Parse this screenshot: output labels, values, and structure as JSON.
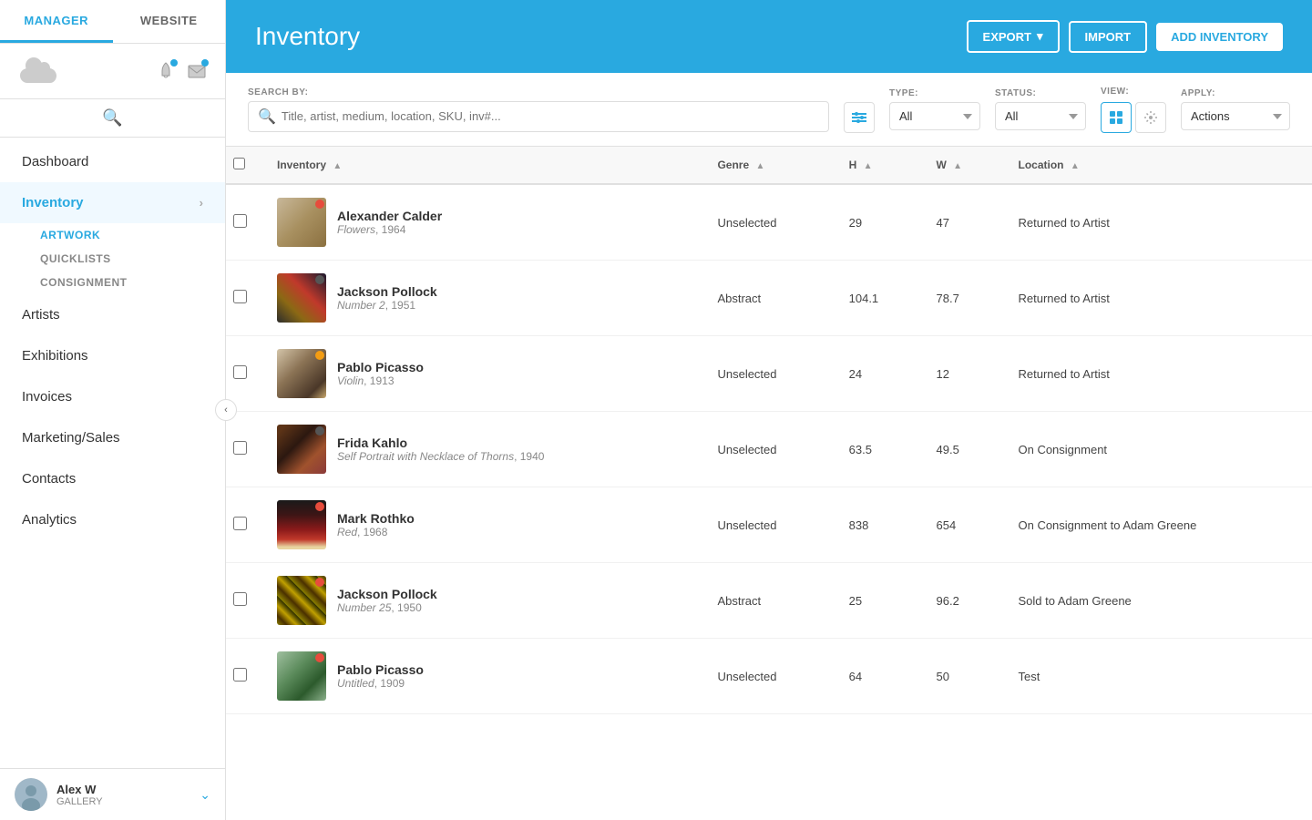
{
  "app": {
    "tab_manager": "MANAGER",
    "tab_website": "WEBSITE"
  },
  "header": {
    "title": "Inventory",
    "export_label": "EXPORT",
    "import_label": "IMPORT",
    "add_label": "ADD INVENTORY"
  },
  "filters": {
    "search_by_label": "SEARCH BY:",
    "search_placeholder": "Title, artist, medium, location, SKU, inv#...",
    "type_label": "TYPE:",
    "type_value": "All",
    "status_label": "STATUS:",
    "status_value": "All",
    "view_label": "VIEW:",
    "apply_label": "APPLY:",
    "actions_value": "Actions"
  },
  "table": {
    "columns": [
      "Inventory",
      "Genre",
      "H",
      "W",
      "Location"
    ],
    "rows": [
      {
        "id": 1,
        "artist": "Alexander Calder",
        "title": "Flowers",
        "year": "1964",
        "genre": "Unselected",
        "h": "29",
        "w": "47",
        "location": "Returned to Artist",
        "status_dot": "red",
        "thumb": "thumb-calder"
      },
      {
        "id": 2,
        "artist": "Jackson Pollock",
        "title": "Number 2",
        "year": "1951",
        "genre": "Abstract",
        "h": "104.1",
        "w": "78.7",
        "location": "Returned to Artist",
        "status_dot": "dark",
        "thumb": "thumb-pollock1"
      },
      {
        "id": 3,
        "artist": "Pablo Picasso",
        "title": "Violin",
        "year": "1913",
        "genre": "Unselected",
        "h": "24",
        "w": "12",
        "location": "Returned to Artist",
        "status_dot": "orange",
        "thumb": "thumb-picasso1"
      },
      {
        "id": 4,
        "artist": "Frida Kahlo",
        "title": "Self Portrait with Necklace of Thorns",
        "year": "1940",
        "genre": "Unselected",
        "h": "63.5",
        "w": "49.5",
        "location": "On Consignment",
        "status_dot": "dark",
        "thumb": "thumb-kahlo"
      },
      {
        "id": 5,
        "artist": "Mark Rothko",
        "title": "Red",
        "year": "1968",
        "genre": "Unselected",
        "h": "838",
        "w": "654",
        "location": "On Consignment to Adam Greene",
        "status_dot": "red",
        "thumb": "thumb-rothko"
      },
      {
        "id": 6,
        "artist": "Jackson Pollock",
        "title": "Number 25",
        "year": "1950",
        "genre": "Abstract",
        "h": "25",
        "w": "96.2",
        "location": "Sold to Adam Greene",
        "status_dot": "red",
        "thumb": "thumb-pollock2"
      },
      {
        "id": 7,
        "artist": "Pablo Picasso",
        "title": "Untitled",
        "year": "1909",
        "genre": "Unselected",
        "h": "64",
        "w": "50",
        "location": "Test",
        "status_dot": "red",
        "thumb": "thumb-picasso2"
      }
    ]
  },
  "sidebar": {
    "nav_items": [
      {
        "id": "dashboard",
        "label": "Dashboard",
        "active": false
      },
      {
        "id": "inventory",
        "label": "Inventory",
        "active": true
      },
      {
        "id": "artists",
        "label": "Artists",
        "active": false
      },
      {
        "id": "exhibitions",
        "label": "Exhibitions",
        "active": false
      },
      {
        "id": "invoices",
        "label": "Invoices",
        "active": false
      },
      {
        "id": "marketing",
        "label": "Marketing/Sales",
        "active": false
      },
      {
        "id": "contacts",
        "label": "Contacts",
        "active": false
      },
      {
        "id": "analytics",
        "label": "Analytics",
        "active": false
      }
    ],
    "sub_items": [
      {
        "id": "artwork",
        "label": "ARTWORK",
        "active": true
      },
      {
        "id": "quicklists",
        "label": "QUICKLISTS",
        "active": false
      },
      {
        "id": "consignment",
        "label": "CONSIGNMENT",
        "active": false
      }
    ],
    "user": {
      "name": "Alex W",
      "subtitle": "GALLERY"
    }
  }
}
